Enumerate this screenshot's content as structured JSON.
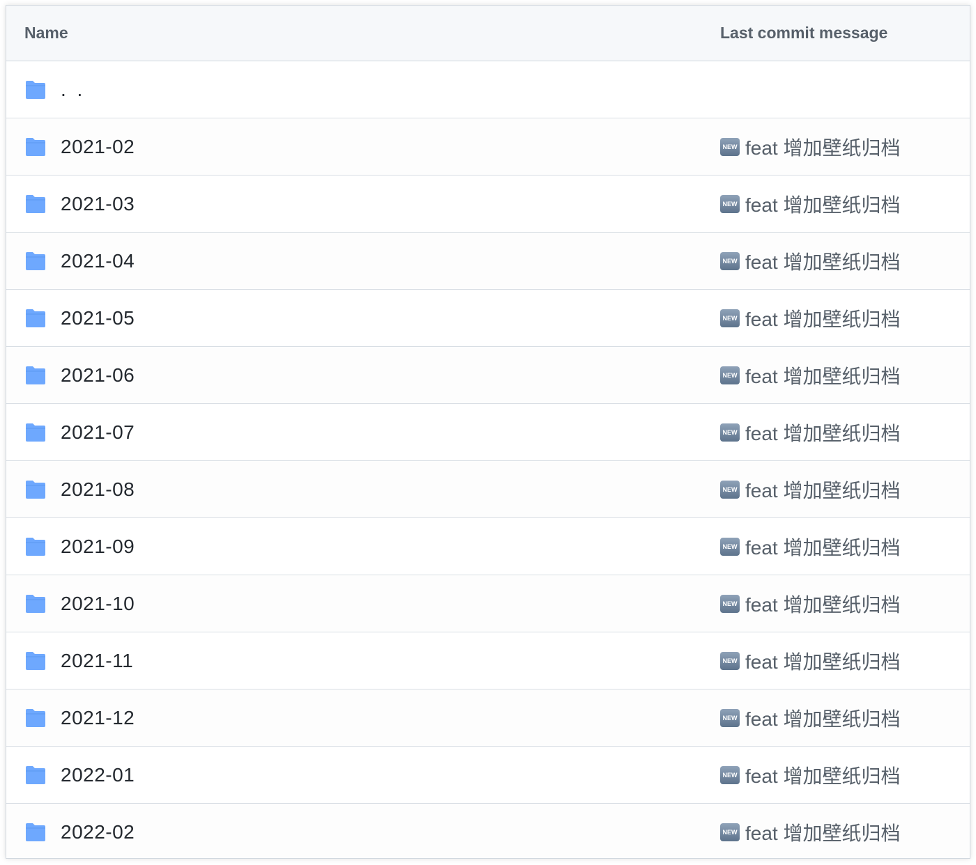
{
  "header": {
    "name_label": "Name",
    "commit_label": "Last commit message"
  },
  "colors": {
    "folder": "#54aeff",
    "header_bg": "#f6f8fa",
    "border": "#d0d7de"
  },
  "parent_row": {
    "name": ". .",
    "icon": "folder-icon"
  },
  "rows": [
    {
      "name": "2021-02",
      "badge": "NEW",
      "commit": "feat 增加壁纸归档"
    },
    {
      "name": "2021-03",
      "badge": "NEW",
      "commit": "feat 增加壁纸归档"
    },
    {
      "name": "2021-04",
      "badge": "NEW",
      "commit": "feat 增加壁纸归档"
    },
    {
      "name": "2021-05",
      "badge": "NEW",
      "commit": "feat 增加壁纸归档"
    },
    {
      "name": "2021-06",
      "badge": "NEW",
      "commit": "feat 增加壁纸归档"
    },
    {
      "name": "2021-07",
      "badge": "NEW",
      "commit": "feat 增加壁纸归档"
    },
    {
      "name": "2021-08",
      "badge": "NEW",
      "commit": "feat 增加壁纸归档"
    },
    {
      "name": "2021-09",
      "badge": "NEW",
      "commit": "feat 增加壁纸归档"
    },
    {
      "name": "2021-10",
      "badge": "NEW",
      "commit": "feat 增加壁纸归档"
    },
    {
      "name": "2021-11",
      "badge": "NEW",
      "commit": "feat 增加壁纸归档"
    },
    {
      "name": "2021-12",
      "badge": "NEW",
      "commit": "feat 增加壁纸归档"
    },
    {
      "name": "2022-01",
      "badge": "NEW",
      "commit": "feat 增加壁纸归档"
    },
    {
      "name": "2022-02",
      "badge": "NEW",
      "commit": "feat 增加壁纸归档"
    }
  ]
}
